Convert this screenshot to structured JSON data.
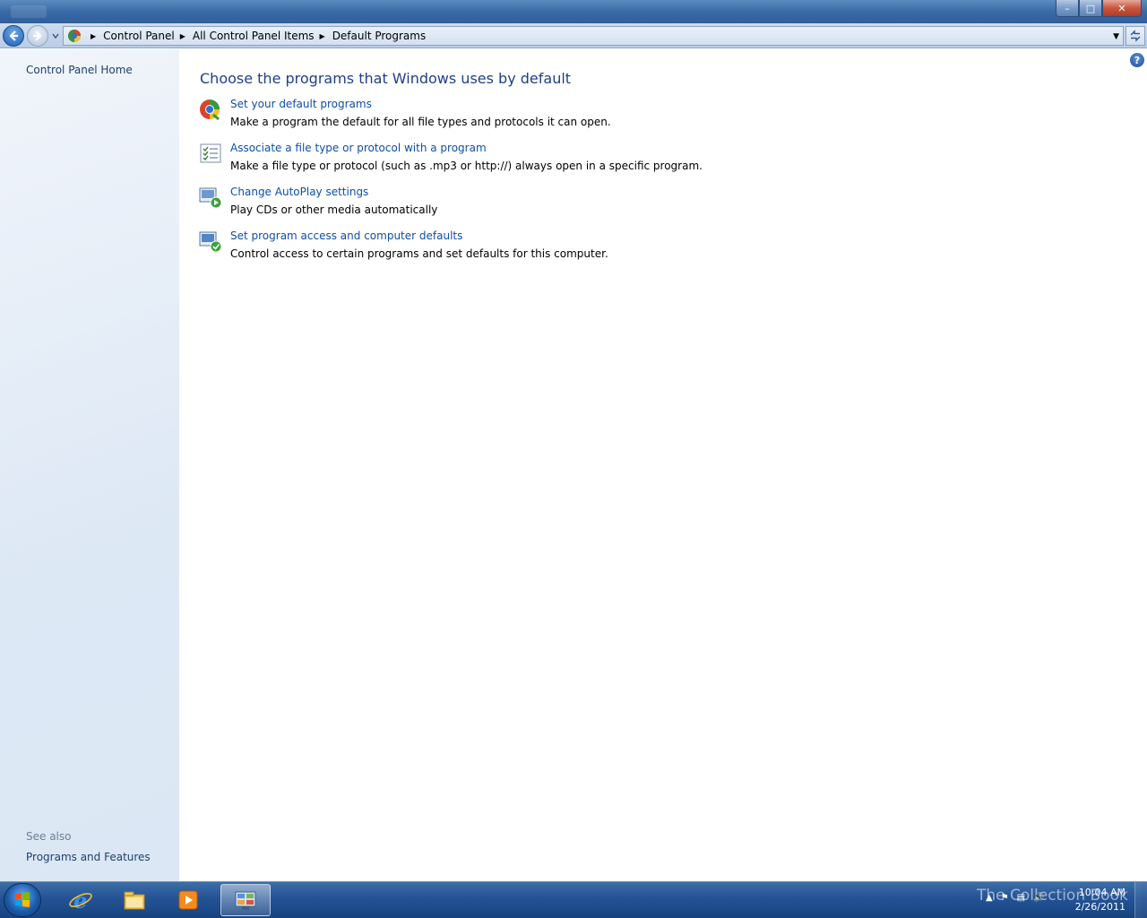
{
  "window": {
    "buttons": {
      "minimize": "–",
      "maximize": "□",
      "close": "✕"
    }
  },
  "address_bar": {
    "breadcrumbs": [
      "Control Panel",
      "All Control Panel Items",
      "Default Programs"
    ]
  },
  "sidebar": {
    "home_link": "Control Panel Home",
    "see_also_label": "See also",
    "see_also_links": [
      "Programs and Features"
    ]
  },
  "main": {
    "heading": "Choose the programs that Windows uses by default",
    "tasks": [
      {
        "link": "Set your default programs",
        "description": "Make a program the default for all file types and protocols it can open.",
        "icon": "default-programs-icon"
      },
      {
        "link": "Associate a file type or protocol with a program",
        "description": "Make a file type or protocol (such as .mp3 or http://) always open in a specific program.",
        "icon": "file-association-icon"
      },
      {
        "link": "Change AutoPlay settings",
        "description": "Play CDs or other media automatically",
        "icon": "autoplay-icon"
      },
      {
        "link": "Set program access and computer defaults",
        "description": "Control access to certain programs and set defaults for this computer.",
        "icon": "program-access-icon"
      }
    ]
  },
  "taskbar": {
    "pinned": [
      "internet-explorer-icon",
      "windows-explorer-icon",
      "media-player-icon",
      "control-panel-icon"
    ],
    "watermark": "The Collection Book",
    "clock": {
      "time": "10:04 AM",
      "date": "2/26/2011"
    }
  },
  "colors": {
    "link": "#0d4fa6",
    "heading": "#1e3f8a",
    "sidebar_bg": "#dde8f5",
    "taskbar": "#245396"
  }
}
